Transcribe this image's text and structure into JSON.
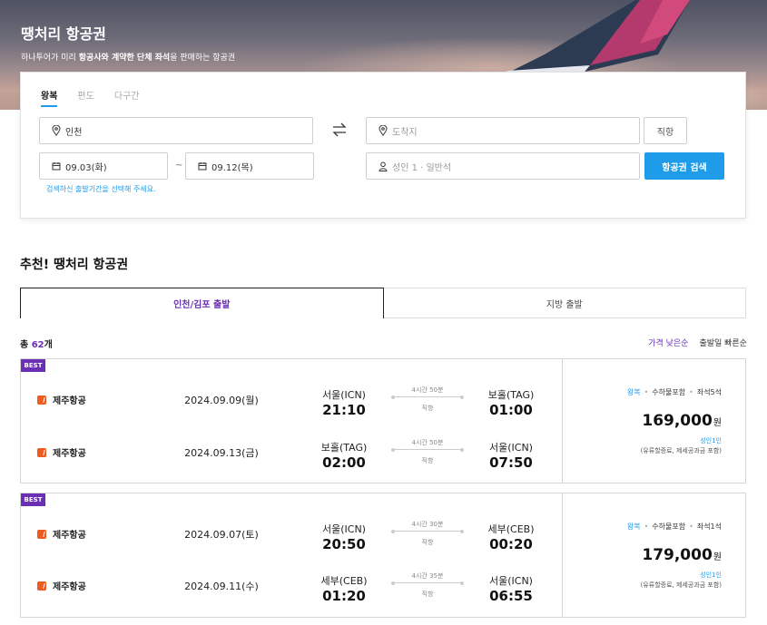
{
  "hero": {
    "title": "땡처리 항공권",
    "subtitle_pre": "하나투어가 미리 ",
    "subtitle_bold1": "항공사와 계약한 단체 좌석",
    "subtitle_post": "을 판매하는 항공권"
  },
  "search": {
    "trip_tabs": [
      "왕복",
      "편도",
      "다구간"
    ],
    "origin": "인천",
    "destination_placeholder": "도착지",
    "direct_label": "직항",
    "depart_date": "09.03(화)",
    "return_date": "09.12(목)",
    "date_separator": "~",
    "passengers": "성인 1 · 일반석",
    "search_button": "항공권 검색",
    "hint": "검색하신 출발기간을 선택해 주세요."
  },
  "recommend": {
    "title": "추천! 땡처리 항공권",
    "region_tabs": [
      "인천/김포 출발",
      "지방 출발"
    ],
    "count_prefix": "총 ",
    "count_num": "62",
    "count_suffix": "개",
    "sort": [
      "가격 낮은순",
      "출발일 빠른순"
    ]
  },
  "tickets": [
    {
      "badge": "BEST",
      "legs": [
        {
          "airline": "제주항공",
          "date": "2024.09.09(월)",
          "from_city": "서울(ICN)",
          "from_time": "21:10",
          "duration": "4시간 50분",
          "stop": "직항",
          "to_city": "보홀(TAG)",
          "to_time": "01:00"
        },
        {
          "airline": "제주항공",
          "date": "2024.09.13(금)",
          "from_city": "보홀(TAG)",
          "from_time": "02:00",
          "duration": "4시간 50분",
          "stop": "직항",
          "to_city": "서울(ICN)",
          "to_time": "07:50"
        }
      ],
      "tag1": "왕복",
      "tag2": "수하물포함",
      "tag3": "좌석5석",
      "price": "169,000",
      "currency": "원",
      "per": "성인1인",
      "incl": "(유류할증료, 제세공과금 포함)"
    },
    {
      "badge": "BEST",
      "legs": [
        {
          "airline": "제주항공",
          "date": "2024.09.07(토)",
          "from_city": "서울(ICN)",
          "from_time": "20:50",
          "duration": "4시간 30분",
          "stop": "직항",
          "to_city": "세부(CEB)",
          "to_time": "00:20"
        },
        {
          "airline": "제주항공",
          "date": "2024.09.11(수)",
          "from_city": "세부(CEB)",
          "from_time": "01:20",
          "duration": "4시간 35분",
          "stop": "직항",
          "to_city": "서울(ICN)",
          "to_time": "06:55"
        }
      ],
      "tag1": "왕복",
      "tag2": "수하물포함",
      "tag3": "좌석1석",
      "price": "179,000",
      "currency": "원",
      "per": "성인1인",
      "incl": "(유류할증료, 제세공과금 포함)"
    }
  ],
  "colors": {
    "accent_blue": "#1e9be9",
    "accent_purple": "#6a2fb5",
    "airline_orange": "#ef5a1f"
  },
  "icons": {
    "location": "location-pin-icon",
    "calendar": "calendar-icon",
    "person": "person-icon",
    "swap": "swap-arrows-icon",
    "airline": "jeju-air-logo-icon"
  }
}
